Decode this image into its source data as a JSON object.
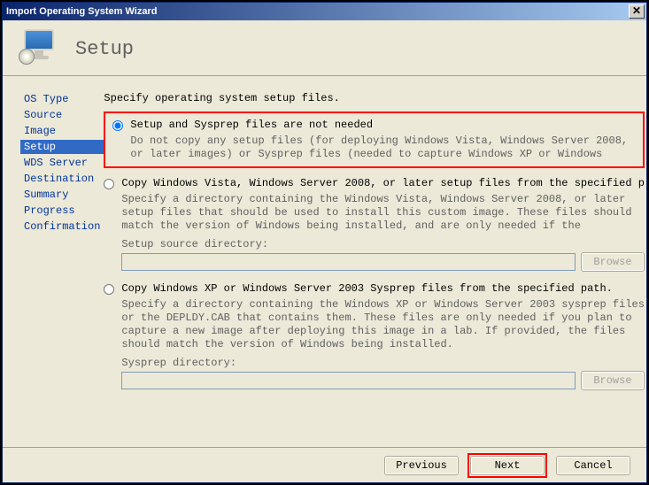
{
  "window": {
    "title": "Import Operating System Wizard"
  },
  "header": {
    "title": "Setup"
  },
  "sidebar": {
    "items": [
      {
        "label": "OS Type"
      },
      {
        "label": "Source"
      },
      {
        "label": "Image"
      },
      {
        "label": "Setup",
        "selected": true
      },
      {
        "label": "WDS Server"
      },
      {
        "label": "Destination"
      },
      {
        "label": "Summary"
      },
      {
        "label": "Progress"
      },
      {
        "label": "Confirmation"
      }
    ]
  },
  "main": {
    "instruction": "Specify operating system setup files.",
    "options": [
      {
        "id": "none",
        "label": "Setup and Sysprep files are not needed",
        "desc": "Do not copy any setup files (for deploying Windows Vista, Windows Server 2008, or later images) or Sysprep files (needed to capture Windows XP or Windows",
        "checked": true
      },
      {
        "id": "vista",
        "label": "Copy Windows Vista, Windows Server 2008, or later setup files from the specified p",
        "desc": "Specify a directory containing the Windows Vista, Windows Server 2008, or later setup files that should be used to install this custom image.  These files should match the version of Windows being installed, and are only needed if the",
        "field_label": "Setup source directory:",
        "field_value": "",
        "browse": "Browse"
      },
      {
        "id": "xp",
        "label": "Copy Windows XP or Windows Server 2003 Sysprep files from the specified path.",
        "desc": "Specify a directory containing the Windows XP or Windows Server 2003 sysprep files or the DEPLDY.CAB that contains them.  These files are only needed  if you plan to capture a new image after deploying this image in a lab.  If provided, the files should match the version of Windows being installed.",
        "field_label": "Sysprep directory:",
        "field_value": "",
        "browse": "Browse"
      }
    ]
  },
  "footer": {
    "previous": "Previous",
    "next": "Next",
    "cancel": "Cancel"
  }
}
